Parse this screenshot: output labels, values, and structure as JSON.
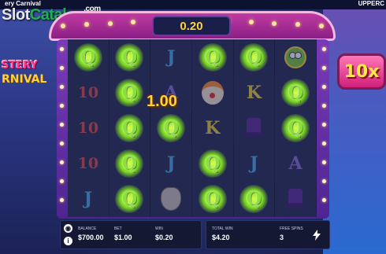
{
  "top_bar": {
    "title": "ery Carnival",
    "right_text": "UPPERC"
  },
  "watermark": {
    "slot": "Slot",
    "catalog": "Catalog",
    "com": ".com"
  },
  "logo": {
    "line1": "STERY",
    "line2": "RNIVAL"
  },
  "multiplier": {
    "label": "10x"
  },
  "win_display": {
    "value": "0.20"
  },
  "overlay_win": {
    "value": "1.00"
  },
  "reels": {
    "rows": [
      [
        "Q",
        "Q",
        "J",
        "Q",
        "Q",
        "frog"
      ],
      [
        "10",
        "Q",
        "A",
        "clown",
        "K",
        "Q"
      ],
      [
        "10",
        "Q",
        "Q",
        "K",
        "hat",
        "Q"
      ],
      [
        "10",
        "Q",
        "J",
        "Q",
        "J",
        "A"
      ],
      [
        "J",
        "Q",
        "mask",
        "Q",
        "Q",
        "hat"
      ]
    ],
    "highlight": "Q"
  },
  "hud": {
    "balance_label": "BALANCE",
    "balance_value": "$700.00",
    "bet_label": "BET",
    "bet_value": "$1.00",
    "win_label": "WIN",
    "win_value": "$0.20",
    "total_win_label": "TOTAL WIN",
    "total_win_value": "$4.20",
    "free_spins_label": "FREE SPINS",
    "free_spins_value": "3"
  },
  "icons": {
    "sound": "speaker-icon",
    "info": "info-icon",
    "turbo": "lightning-icon"
  }
}
